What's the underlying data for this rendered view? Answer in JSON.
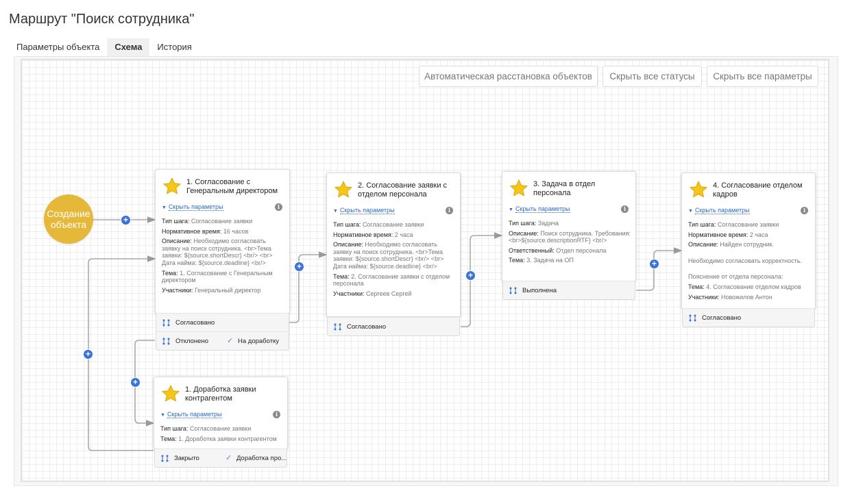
{
  "page": {
    "title": "Маршрут \"Поиск сотрудника\"",
    "tabs": [
      "Параметры объекта",
      "Схема",
      "История"
    ],
    "active_tab": "Схема"
  },
  "toolbar": {
    "auto_arrange": "Автоматическая расстановка объектов",
    "hide_statuses": "Скрыть все статусы",
    "hide_params": "Скрыть все параметры"
  },
  "start_node": {
    "label": "Создание объекта"
  },
  "common": {
    "hide_params": "Скрыть параметры"
  },
  "cards": [
    {
      "title": "1. Согласование с Генеральным директором",
      "params": [
        {
          "k": "Тип шага: ",
          "v": "Согласование заявки"
        },
        {
          "k": "Нормативное время: ",
          "v": "16 часов"
        },
        {
          "k": "Описание: ",
          "v": "Необходимо согласовать заявку на поиск сотрудника. <br>Тема заявки: ${source.shortDescr} <br/> <br> Дата найма: ${source.deadline} <br/>"
        },
        {
          "k": "Тема: ",
          "v": "1. Согласование с Генеральным директором"
        },
        {
          "k": "Участники: ",
          "v": "Генеральный директор"
        }
      ],
      "outcomes": [
        [
          "Согласовано"
        ],
        [
          "Отклонено",
          "На доработку"
        ]
      ]
    },
    {
      "title": "2. Согласование заявки с отделом персонала",
      "params": [
        {
          "k": "Тип шага: ",
          "v": "Согласование заявки"
        },
        {
          "k": "Нормативное время: ",
          "v": "2 часа"
        },
        {
          "k": "Описание: ",
          "v": "Необходимо согласовать заявку на поиск сотрудника. <br>Тема заявки: ${source.shortDescr} <br/> <br> Дата найма: ${source.deadline} <br/>"
        },
        {
          "k": "Тема: ",
          "v": "2. Согласование заявки с отделом персонала"
        },
        {
          "k": "Участники: ",
          "v": "Сергеев Сергей"
        }
      ],
      "outcomes": [
        [
          "Согласовано"
        ]
      ]
    },
    {
      "title": "3. Задача в отдел персонала",
      "params": [
        {
          "k": "Тип шага: ",
          "v": "Задача"
        },
        {
          "k": "Описание: ",
          "v": "Поиск сотрудника. Требования: <br>${source.descriptionRTF} <br/>"
        },
        {
          "k": "Ответственный: ",
          "v": "Отдел персонала"
        },
        {
          "k": "Тема: ",
          "v": "3. Задача на ОП"
        }
      ],
      "outcomes": [
        [
          "Выполнена"
        ]
      ]
    },
    {
      "title": "4. Согласование отделом кадров",
      "params": [
        {
          "k": "Тип шага: ",
          "v": "Согласование заявки"
        },
        {
          "k": "Нормативное время: ",
          "v": "2 часа"
        },
        {
          "k": "Описание: ",
          "v": "Найден сотрудник."
        },
        {
          "k": "",
          "v": "Необходимо согласовать корректность."
        },
        {
          "k": "",
          "v": "Пояснение от отдела персонала:"
        },
        {
          "k": "Тема: ",
          "v": "4. Согласование отделом кадров"
        },
        {
          "k": "Участники: ",
          "v": "Новожилов Антон"
        }
      ],
      "outcomes": [
        [
          "Согласовано"
        ]
      ]
    },
    {
      "title": "1. Доработка заявки контрагентом",
      "params": [
        {
          "k": "Тип шага: ",
          "v": "Согласование заявки"
        },
        {
          "k": "Тема: ",
          "v": "1. Доработка заявки контрагентом"
        }
      ],
      "outcomes": [
        [
          "Закрыто",
          "Доработка про..."
        ]
      ]
    }
  ],
  "colors": {
    "accent": "#3b72d9",
    "start_node": "#e6b83a",
    "link": "#a8a8a8",
    "star": "#f5c518"
  }
}
